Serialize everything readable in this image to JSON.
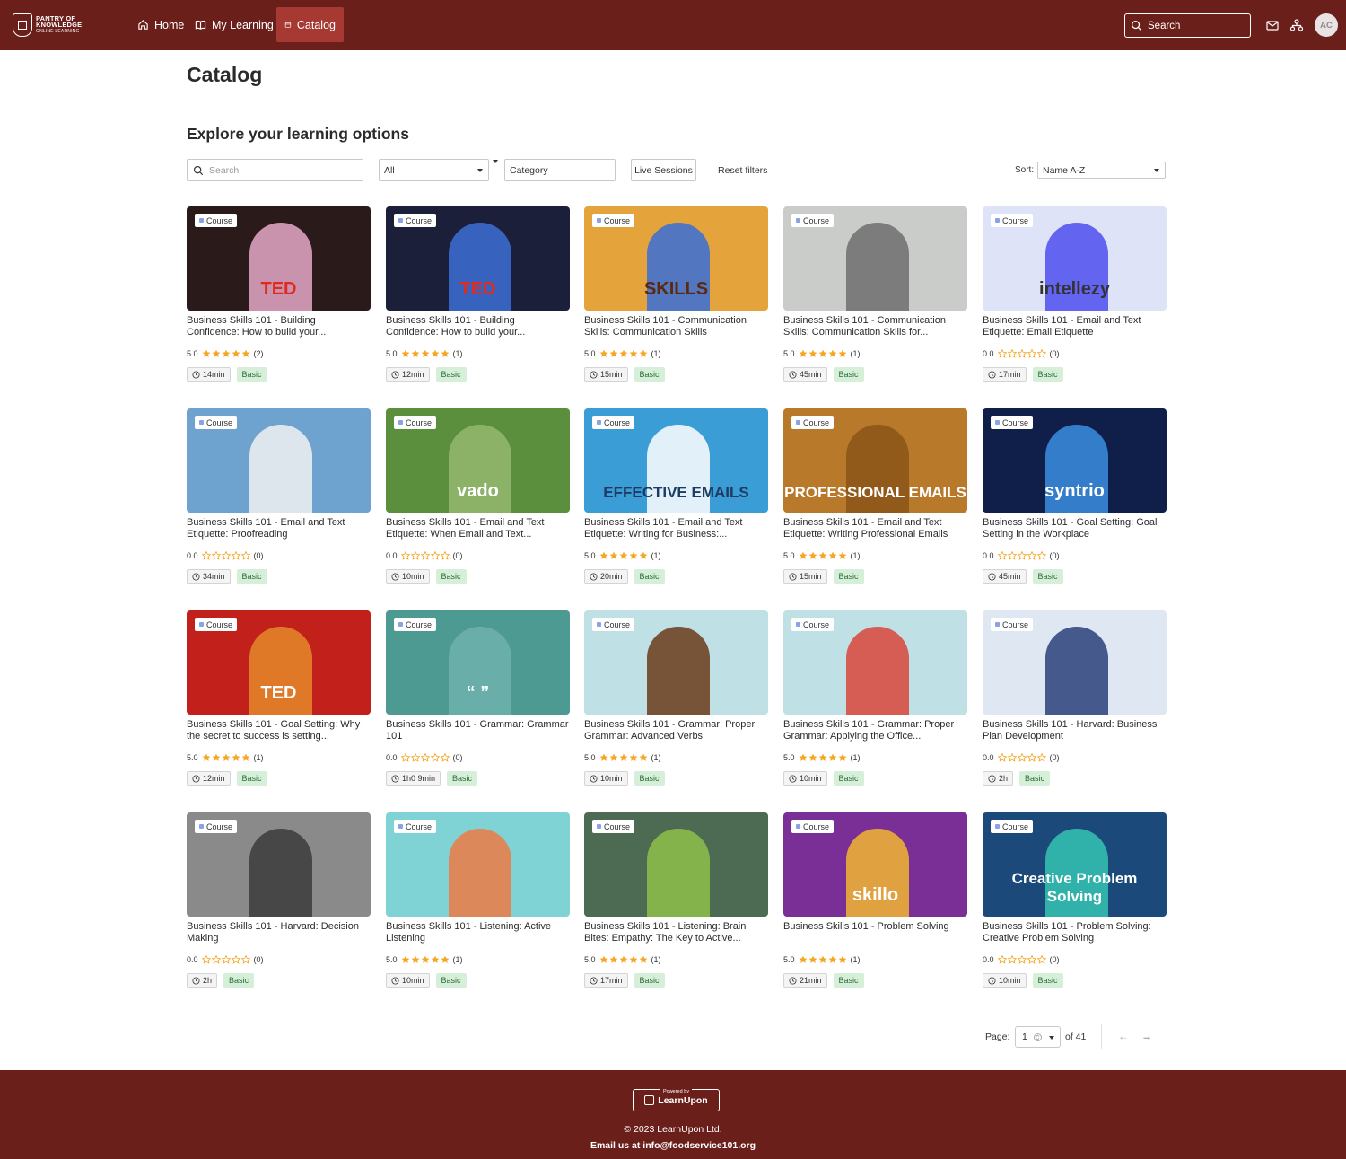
{
  "nav": {
    "logo_line1": "PANTRY OF",
    "logo_line2": "KNOWLEDGE",
    "logo_line3": "ONLINE LEARNING",
    "home": "Home",
    "my_learning": "My Learning",
    "catalog": "Catalog",
    "search": "Search",
    "avatar": "AC"
  },
  "page": {
    "title": "Catalog",
    "section_title": "Explore your learning options"
  },
  "filters": {
    "search_placeholder": "Search",
    "type_value": "All",
    "category_value": "Category",
    "live_sessions": "Live Sessions",
    "reset": "Reset filters",
    "sort_label": "Sort:",
    "sort_value": "Name A-Z"
  },
  "badge_label": "Course",
  "courses": [
    {
      "title": "Business Skills 101 - Building Confidence: How to build your...",
      "rating": "5.0",
      "stars": 5,
      "count": "(2)",
      "duration": "14min",
      "level": "Basic",
      "thumb_text": "TED",
      "bg": "#2a1a1a",
      "accent": "#e5a9c8",
      "text_color": "#e12a1f"
    },
    {
      "title": "Business Skills 101 - Building Confidence: How to build your...",
      "rating": "5.0",
      "stars": 5,
      "count": "(1)",
      "duration": "12min",
      "level": "Basic",
      "thumb_text": "TED",
      "bg": "#1c1f3a",
      "accent": "#3c6fd6",
      "text_color": "#e12a1f"
    },
    {
      "title": "Business Skills 101 - Communication Skills: Communication Skills",
      "rating": "5.0",
      "stars": 5,
      "count": "(1)",
      "duration": "15min",
      "level": "Basic",
      "thumb_text": "SKILLS",
      "bg": "#e4a33b",
      "accent": "#3a6ed8",
      "text_color": "#5a2a10"
    },
    {
      "title": "Business Skills 101 - Communication Skills: Communication Skills for...",
      "rating": "5.0",
      "stars": 5,
      "count": "(1)",
      "duration": "45min",
      "level": "Basic",
      "thumb_text": "",
      "bg": "#c9ccc9",
      "accent": "#6d6d6d",
      "text_color": "#ffffff"
    },
    {
      "title": "Business Skills 101 - Email and Text Etiquette: Email Etiquette",
      "rating": "0.0",
      "stars": 0,
      "count": "(0)",
      "duration": "17min",
      "level": "Basic",
      "thumb_text": "intellezy",
      "bg": "#dfe3f7",
      "accent": "#4e4ff0",
      "text_color": "#333333"
    },
    {
      "title": "Business Skills 101 - Email and Text Etiquette: Proofreading",
      "rating": "0.0",
      "stars": 0,
      "count": "(0)",
      "duration": "34min",
      "level": "Basic",
      "thumb_text": "",
      "bg": "#6ea2cf",
      "accent": "#f2f2f2",
      "text_color": "#d43a2a"
    },
    {
      "title": "Business Skills 101 - Email and Text Etiquette: When Email and Text...",
      "rating": "0.0",
      "stars": 0,
      "count": "(0)",
      "duration": "10min",
      "level": "Basic",
      "thumb_text": "vado",
      "bg": "#5c8f3d",
      "accent": "#93b86e",
      "text_color": "#ffffff"
    },
    {
      "title": "Business Skills 101 - Email and Text Etiquette: Writing for Business:...",
      "rating": "5.0",
      "stars": 5,
      "count": "(1)",
      "duration": "20min",
      "level": "Basic",
      "thumb_text": "EFFECTIVE EMAILS",
      "bg": "#3a9dd6",
      "accent": "#ffffff",
      "text_color": "#1d3b63"
    },
    {
      "title": "Business Skills 101 - Email and Text Etiquette: Writing Professional Emails",
      "rating": "5.0",
      "stars": 5,
      "count": "(1)",
      "duration": "15min",
      "level": "Basic",
      "thumb_text": "PROFESSIONAL EMAILS",
      "bg": "#b87a2a",
      "accent": "#8a5518",
      "text_color": "#ffffff"
    },
    {
      "title": "Business Skills 101 - Goal Setting: Goal Setting in the Workplace",
      "rating": "0.0",
      "stars": 0,
      "count": "(0)",
      "duration": "45min",
      "level": "Basic",
      "thumb_text": "syntrio",
      "bg": "#0f1f4a",
      "accent": "#3a8ee0",
      "text_color": "#ffffff"
    },
    {
      "title": "Business Skills 101 - Goal Setting: Why the secret to success is setting...",
      "rating": "5.0",
      "stars": 5,
      "count": "(1)",
      "duration": "12min",
      "level": "Basic",
      "thumb_text": "TED",
      "bg": "#c2201b",
      "accent": "#e48a2a",
      "text_color": "#ffffff"
    },
    {
      "title": "Business Skills 101 - Grammar: Grammar 101",
      "rating": "0.0",
      "stars": 0,
      "count": "(0)",
      "duration": "1h0 9min",
      "level": "Basic",
      "thumb_text": "“ ”",
      "bg": "#4d9a93",
      "accent": "#6fb1ab",
      "text_color": "#ffffff"
    },
    {
      "title": "Business Skills 101 - Grammar: Proper Grammar: Advanced Verbs",
      "rating": "5.0",
      "stars": 5,
      "count": "(1)",
      "duration": "10min",
      "level": "Basic",
      "thumb_text": "",
      "bg": "#bfe0e4",
      "accent": "#6a3a1a",
      "text_color": "#ffffff"
    },
    {
      "title": "Business Skills 101 - Grammar: Proper Grammar: Applying the Office...",
      "rating": "5.0",
      "stars": 5,
      "count": "(1)",
      "duration": "10min",
      "level": "Basic",
      "thumb_text": "",
      "bg": "#bfe0e4",
      "accent": "#d8453a",
      "text_color": "#ffffff"
    },
    {
      "title": "Business Skills 101 - Harvard: Business Plan Development",
      "rating": "0.0",
      "stars": 0,
      "count": "(0)",
      "duration": "2h",
      "level": "Basic",
      "thumb_text": "",
      "bg": "#dfe7f2",
      "accent": "#2a3f7a",
      "text_color": "#ffffff"
    },
    {
      "title": "Business Skills 101 - Harvard: Decision Making",
      "rating": "0.0",
      "stars": 0,
      "count": "(0)",
      "duration": "2h",
      "level": "Basic",
      "thumb_text": "",
      "bg": "#8a8a8a",
      "accent": "#3b3b3b",
      "text_color": "#ffffff"
    },
    {
      "title": "Business Skills 101 - Listening: Active Listening",
      "rating": "5.0",
      "stars": 5,
      "count": "(1)",
      "duration": "10min",
      "level": "Basic",
      "thumb_text": "",
      "bg": "#7fd3d4",
      "accent": "#ec7a45",
      "text_color": "#ffffff"
    },
    {
      "title": "Business Skills 101 - Listening: Brain Bites: Empathy: The Key to Active...",
      "rating": "5.0",
      "stars": 5,
      "count": "(1)",
      "duration": "17min",
      "level": "Basic",
      "thumb_text": "",
      "bg": "#4d6a52",
      "accent": "#8fc04a",
      "text_color": "#ffffff"
    },
    {
      "title": "Business Skills 101 - Problem Solving",
      "rating": "5.0",
      "stars": 5,
      "count": "(1)",
      "duration": "21min",
      "level": "Basic",
      "thumb_text": "skillo",
      "bg": "#7a2f96",
      "accent": "#f2b631",
      "text_color": "#ffffff"
    },
    {
      "title": "Business Skills 101 - Problem Solving: Creative Problem Solving",
      "rating": "0.0",
      "stars": 0,
      "count": "(0)",
      "duration": "10min",
      "level": "Basic",
      "thumb_text": "Creative Problem Solving",
      "bg": "#1b4a7a",
      "accent": "#34c3b3",
      "text_color": "#ffffff"
    }
  ],
  "pagination": {
    "label": "Page:",
    "value": "1",
    "of": "of 41",
    "prev": "←",
    "next": "→"
  },
  "footer": {
    "powered_by": "Powered by",
    "brand": "LearnUpon",
    "copyright": "© 2023 LearnUpon Ltd.",
    "email": "Email us at info@foodservice101.org"
  },
  "colors": {
    "brand": "#6b1f1b",
    "nav_active": "#a63a32",
    "star": "#f5a623",
    "level_chip": "#d6efd9"
  }
}
